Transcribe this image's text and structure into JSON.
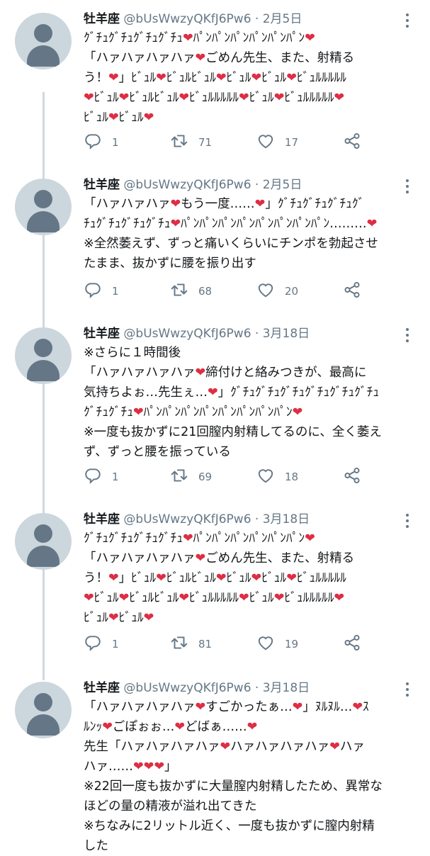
{
  "tweets": [
    {
      "name": "牡羊座",
      "handle": "@bUsWwzyQKfJ6Pw6",
      "date": "· 2月5日",
      "lines": [
        "ｸﾞﾁｭｸﾞﾁｭｸﾞﾁｭｸﾞﾁｭ❤ﾊﾟﾝﾊﾟﾝﾊﾟﾝﾊﾟﾝﾊﾟﾝﾊﾟﾝ❤",
        "「ハァハァハァハァ❤ごめん先生、また、射精る",
        "う！❤」ﾋﾞｭﾙ❤ﾋﾞｭﾙﾋﾞｭﾙ❤ﾋﾞｭﾙ❤ﾋﾞｭﾙ❤ﾋﾞｭﾙﾙﾙﾙﾙ",
        "❤ﾋﾞｭﾙ❤ﾋﾞｭﾙﾋﾞｭﾙ❤ﾋﾞｭﾙﾙﾙﾙﾙ❤ﾋﾞｭﾙ❤ﾋﾞｭﾙﾙﾙﾙﾙ❤",
        "ﾋﾞｭﾙ❤ﾋﾞｭﾙ❤"
      ],
      "reply_count": "1",
      "retweet_count": "71",
      "like_count": "17"
    },
    {
      "name": "牡羊座",
      "handle": "@bUsWwzyQKfJ6Pw6",
      "date": "· 2月5日",
      "lines": [
        "「ハァハァハァ❤もう一度……❤」ｸﾞﾁｭｸﾞﾁｭｸﾞﾁｭｸﾞ",
        "ﾁｭｸﾞﾁｭｸﾞﾁｭｸﾞﾁｭ❤ﾊﾟﾝﾊﾟﾝﾊﾟﾝﾊﾟﾝﾊﾟﾝﾊﾟﾝﾊﾟﾝﾊﾟﾝ………❤",
        "※全然萎えず、ずっと痛いくらいにチンポを勃起させ",
        "たまま、抜かずに腰を振り出す"
      ],
      "reply_count": "1",
      "retweet_count": "68",
      "like_count": "20"
    },
    {
      "name": "牡羊座",
      "handle": "@bUsWwzyQKfJ6Pw6",
      "date": "· 3月18日",
      "lines": [
        "※さらに１時間後",
        "「ハァハァハァハァ❤締付けと絡みつきが、最高に",
        "気持ちよぉ…先生ぇ…❤」ｸﾞﾁｭｸﾞﾁｭｸﾞﾁｭｸﾞﾁｭｸﾞﾁｭｸﾞﾁｭ",
        "ｸﾞﾁｭｸﾞﾁｭ❤ﾊﾟﾝﾊﾟﾝﾊﾟﾝﾊﾟﾝﾊﾟﾝﾊﾟﾝﾊﾟﾝﾊﾟﾝ❤",
        "※一度も抜かずに21回膣内射精してるのに、全く萎え",
        "ず、ずっと腰を振っている"
      ],
      "reply_count": "1",
      "retweet_count": "69",
      "like_count": "18"
    },
    {
      "name": "牡羊座",
      "handle": "@bUsWwzyQKfJ6Pw6",
      "date": "· 3月18日",
      "lines": [
        "ｸﾞﾁｭｸﾞﾁｭｸﾞﾁｭｸﾞﾁｭ❤ﾊﾟﾝﾊﾟﾝﾊﾟﾝﾊﾟﾝﾊﾟﾝﾊﾟﾝ❤",
        "「ハァハァハァハァ❤ごめん先生、また、射精る",
        "う！❤」ﾋﾞｭﾙ❤ﾋﾞｭﾙﾋﾞｭﾙ❤ﾋﾞｭﾙ❤ﾋﾞｭﾙ❤ﾋﾞｭﾙﾙﾙﾙﾙ",
        "❤ﾋﾞｭﾙ❤ﾋﾞｭﾙﾋﾞｭﾙ❤ﾋﾞｭﾙﾙﾙﾙﾙ❤ﾋﾞｭﾙ❤ﾋﾞｭﾙﾙﾙﾙﾙ❤",
        "ﾋﾞｭﾙ❤ﾋﾞｭﾙ❤"
      ],
      "reply_count": "1",
      "retweet_count": "81",
      "like_count": "19"
    },
    {
      "name": "牡羊座",
      "handle": "@bUsWwzyQKfJ6Pw6",
      "date": "· 3月18日",
      "lines": [
        "「ハァハァハァハァ❤すごかったぁ…❤」ﾇﾙﾇﾙ…❤ｽ",
        "ﾙﾝｯ❤ごぽぉぉ…❤どばぁ……❤",
        "先生「ハァハァハァハァ❤ハァハァハァハァ❤ハァ",
        "ハァ……❤❤❤」",
        "※22回一度も抜かずに大量膣内射精したため、異常な",
        "ほどの量の精液が溢れ出てきた",
        "※ちなみに2リットル近く、一度も抜かずに膣内射精",
        "した"
      ]
    }
  ]
}
